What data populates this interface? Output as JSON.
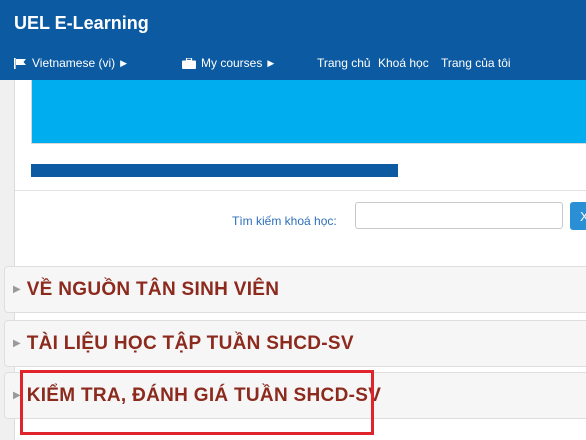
{
  "header": {
    "brand": "UEL E-Learning",
    "nav": {
      "language": "Vietnamese (vi)",
      "my_courses": "My courses",
      "home": "Trang chủ",
      "courses": "Khoá học",
      "my_page": "Trang của tôi"
    }
  },
  "search": {
    "label": "Tìm kiếm khoá học:",
    "value": "",
    "button_label": "X"
  },
  "sections": [
    {
      "title": "VỀ NGUỒN TÂN SINH VIÊN"
    },
    {
      "title": "TÀI LIỆU HỌC TẬP TUẦN SHCD-SV"
    },
    {
      "title": "KIỂM TRA, ĐÁNH GIÁ TUẦN SHCD-SV"
    }
  ],
  "colors": {
    "header_bg": "#0b5aa2",
    "banner": "#00aeef",
    "section_title": "#8c2a1d",
    "highlight": "#e0242b"
  },
  "icons": {
    "language": "flag-icon",
    "my_courses": "briefcase-icon",
    "caret": "caret-right-icon",
    "section_toggle": "triangle-right-icon"
  }
}
